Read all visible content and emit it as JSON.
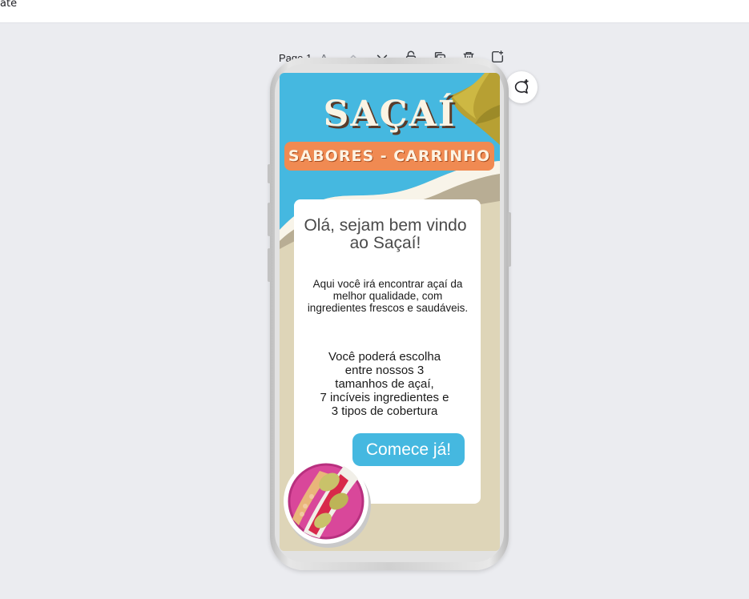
{
  "topbar": {
    "label": "ate"
  },
  "page_toolbar": {
    "page_label_prefix": "Page 1 -",
    "page_label_suffix": " A..",
    "icons": [
      "chevron-up-icon",
      "chevron-down-icon",
      "lock-icon",
      "duplicate-icon",
      "trash-icon",
      "add-page-icon"
    ]
  },
  "comment": {
    "icon": "add-comment-icon"
  },
  "design": {
    "brand": "SAÇAÍ",
    "subtitle": "SABORES - CARRINHO",
    "welcome": "Olá, sejam bem vindo ao Saçaí!",
    "description": "Aqui você irá encontrar açaí da melhor qualidade, com ingredientes frescos e saudáveis.",
    "options_lines": [
      "Você poderá escolha",
      "entre nossos 3",
      "tamanhos de açaí,",
      "7 incíveis ingredientes e",
      "3 tipos de cobertura"
    ],
    "cta": "Comece já!",
    "colors": {
      "sky": "#45b8e0",
      "sand": "#ded5b8",
      "orange": "#f08a52",
      "leaf": "#b7a033",
      "white": "#ffffff"
    }
  }
}
